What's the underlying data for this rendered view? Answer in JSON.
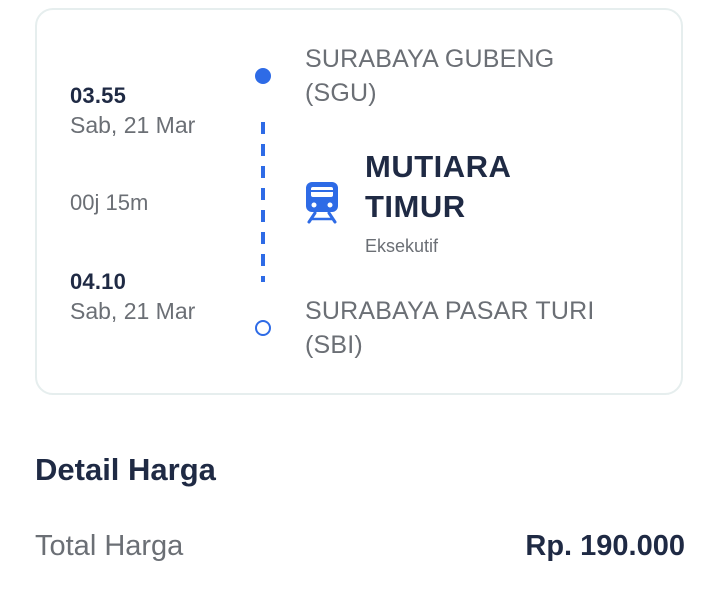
{
  "trip": {
    "departure": {
      "time": "03.55",
      "date": "Sab, 21 Mar",
      "station_name": "SURABAYA GUBENG",
      "station_code": "(SGU)"
    },
    "duration": "00j 15m",
    "arrival": {
      "time": "04.10",
      "date": "Sab, 21 Mar",
      "station_name": "SURABAYA PASAR TURI",
      "station_code": "(SBI)"
    },
    "train": {
      "name_line1": "MUTIARA",
      "name_line2": "TIMUR",
      "class": "Eksekutif",
      "icon": "train-icon"
    }
  },
  "price": {
    "section_title": "Detail Harga",
    "total_label": "Total Harga",
    "total_value": "Rp. 190.000"
  },
  "colors": {
    "accent": "#2e6be6",
    "heading": "#1f2a44",
    "muted": "#6b6f75",
    "card_border": "#e6eeee"
  }
}
